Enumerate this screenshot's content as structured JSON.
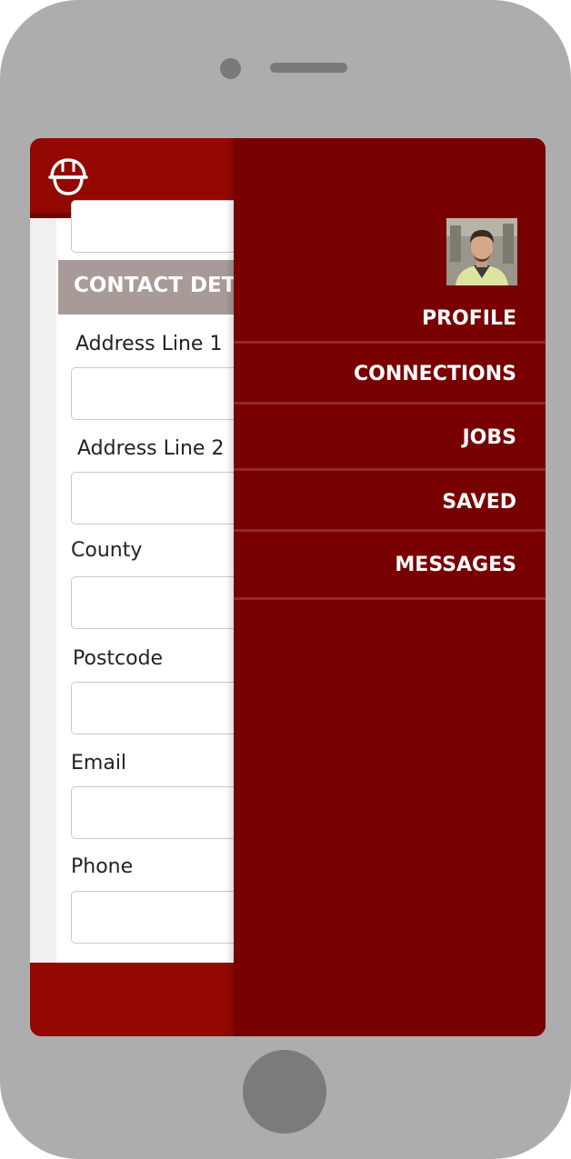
{
  "colors": {
    "brand_red": "#930800",
    "drawer_red": "#780000",
    "section_header_bg": "#a89a97",
    "device_frame": "#adadad"
  },
  "header": {
    "logo_icon": "hard-hat-icon"
  },
  "form": {
    "section_title": "CONTACT DETA",
    "fields": [
      {
        "label": "Address Line 1",
        "value": ""
      },
      {
        "label": "Address Line 2",
        "value": ""
      },
      {
        "label": "County",
        "value": ""
      },
      {
        "label": "Postcode",
        "value": ""
      },
      {
        "label": "Email",
        "value": ""
      },
      {
        "label": "Phone",
        "value": ""
      }
    ]
  },
  "drawer": {
    "avatar_icon": "user-avatar",
    "items": [
      {
        "label": "PROFILE"
      },
      {
        "label": "CONNECTIONS"
      },
      {
        "label": "JOBS"
      },
      {
        "label": "SAVED"
      },
      {
        "label": "MESSAGES"
      }
    ]
  }
}
